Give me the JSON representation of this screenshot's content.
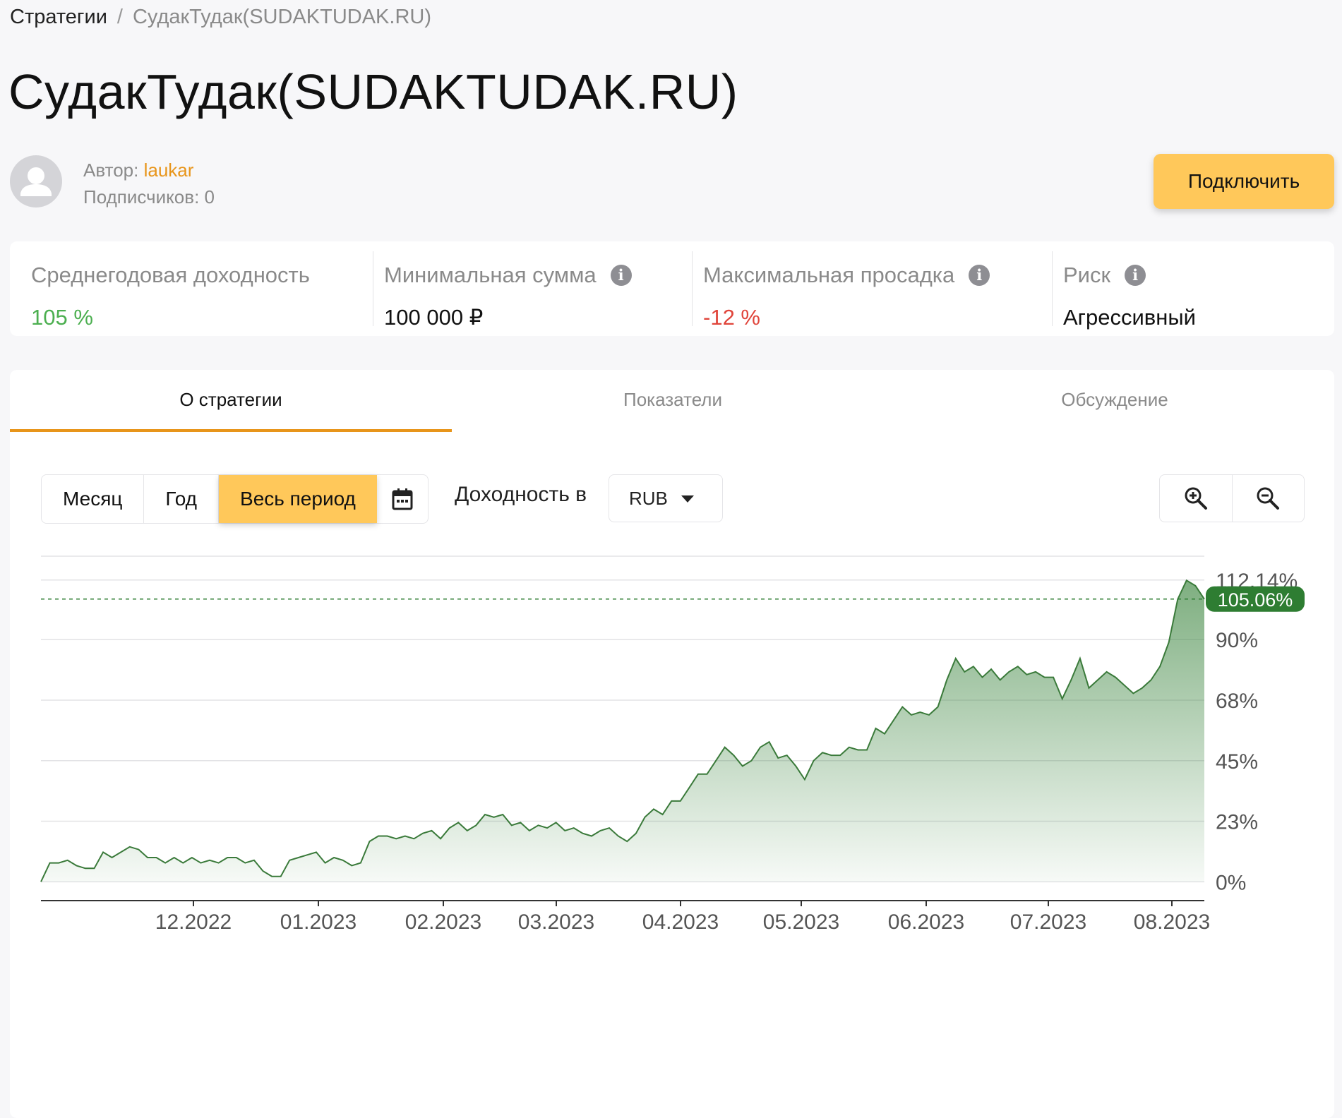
{
  "breadcrumb": {
    "root": "Стратегии",
    "separator": "/",
    "current": "СудакТудак(SUDAKTUDAK.RU)"
  },
  "title": "СудакТудак(SUDAKTUDAK.RU)",
  "author": {
    "label": "Автор: ",
    "name": "laukar",
    "subscribers": "Подписчиков: 0"
  },
  "connect_label": "Подключить",
  "stats": {
    "annual": {
      "label": "Среднегодовая доходность",
      "value": "105 %",
      "color": "#4caf50"
    },
    "min_sum": {
      "label": "Минимальная сумма",
      "value": "100 000 ₽",
      "icon": "info-icon"
    },
    "drawdown": {
      "label": "Максимальная просадка",
      "value": "-12 %",
      "color": "#e0453b",
      "icon": "info-icon"
    },
    "risk": {
      "label": "Риск",
      "value": "Агрессивный",
      "icon": "info-icon"
    }
  },
  "tabs": [
    {
      "label": "О стратегии",
      "active": true
    },
    {
      "label": "Показатели",
      "active": false
    },
    {
      "label": "Обсуждение",
      "active": false
    }
  ],
  "period": {
    "month": "Месяц",
    "year": "Год",
    "all": "Весь период",
    "selected": "Весь период",
    "calendar_icon": "calendar-icon"
  },
  "yield_in_label": "Доходность в",
  "currency": "RUB",
  "zoom": {
    "in_icon": "zoom-in-icon",
    "out_icon": "zoom-out-icon"
  },
  "colors": {
    "accent": "#ffc85a",
    "accent_line": "#e8951a",
    "chart_line": "#3a7a3a",
    "chart_fill": "#2f7d32",
    "badge": "#2e7d32"
  },
  "chart_data": {
    "type": "area",
    "y_unit": "%",
    "y_ticks": [
      "0%",
      "23%",
      "45%",
      "68%",
      "90%",
      "112.14%"
    ],
    "y_tick_values": [
      0,
      22.5,
      45,
      67.5,
      90,
      112.14
    ],
    "x_ticks": [
      "12.2022",
      "01.2023",
      "02.2023",
      "03.2023",
      "04.2023",
      "05.2023",
      "06.2023",
      "07.2023",
      "08.2023"
    ],
    "current_value_label": "105.06%",
    "current_value": 105.06,
    "ylim": [
      -7,
      121
    ],
    "grid": true,
    "series": [
      {
        "values": [
          0,
          7,
          7,
          8,
          6,
          5,
          5,
          11,
          9,
          11,
          13,
          12,
          9,
          9,
          7,
          9,
          7,
          9,
          7,
          8,
          7,
          9,
          9,
          7,
          8,
          4,
          2,
          2,
          8,
          9,
          10,
          11,
          7,
          9,
          8,
          6,
          7,
          15,
          17,
          17,
          16,
          17,
          16,
          18,
          19,
          16,
          20,
          22,
          19,
          21,
          25,
          24,
          25,
          21,
          22,
          19,
          21,
          20,
          22,
          19,
          20,
          18,
          17,
          19,
          20,
          17,
          15,
          18,
          24,
          27,
          25,
          30,
          30,
          35,
          40,
          40,
          45,
          50,
          47,
          43,
          45,
          50,
          52,
          46,
          47,
          43,
          38,
          45,
          48,
          47,
          47,
          50,
          49,
          49,
          57,
          55,
          60,
          65,
          62,
          63,
          62,
          65,
          75,
          83,
          78,
          80,
          76,
          79,
          75,
          78,
          80,
          77,
          78,
          76,
          76,
          68,
          75,
          83,
          72,
          75,
          78,
          76,
          73,
          70,
          72,
          75,
          80,
          89,
          105,
          112,
          110,
          105.06
        ]
      }
    ]
  }
}
